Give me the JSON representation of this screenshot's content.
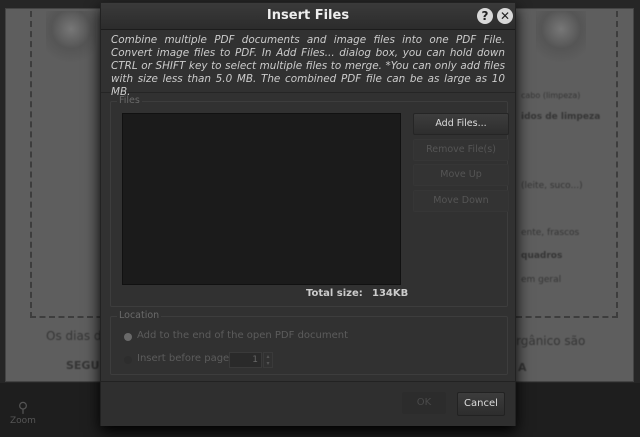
{
  "background": {
    "fragments": [
      "Os dias d",
      "SEGU",
      "rgânico são",
      "A",
      "idos de limpeza",
      "(leite, suco...)",
      "ente, frascos",
      "quadros",
      "em geral",
      "cabo (limpeza)"
    ],
    "zoom_label": "Zoom"
  },
  "dialog": {
    "title": "Insert Files",
    "description": "Combine multiple PDF documents and image files into one PDF File. Convert image files to PDF.  In Add Files... dialog box, you can hold down CTRL or SHIFT key to select multiple files to merge. *You can only add files with size less than 5.0 MB. The combined PDF file can be as large as 10 MB.",
    "files_group": {
      "label": "Files",
      "buttons": [
        "Add Files...",
        "Remove File(s)",
        "Move Up",
        "Move Down"
      ],
      "total_label": "Total size:",
      "total_value": "134KB"
    },
    "location_group": {
      "label": "Location",
      "option_end": "Add to the end of the open PDF document",
      "option_before": "Insert before page:",
      "page_value": "1",
      "selected": "end"
    },
    "footer": {
      "ok": "OK",
      "cancel": "Cancel"
    }
  }
}
